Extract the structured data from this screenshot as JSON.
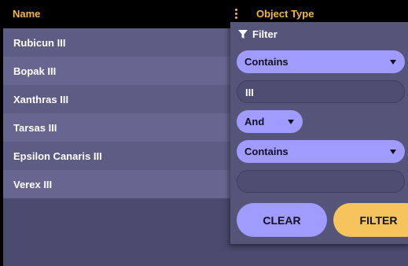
{
  "grid": {
    "columns": {
      "name": "Name",
      "object_type": "Object Type"
    },
    "rows": [
      {
        "name": "Rubicun III"
      },
      {
        "name": "Bopak III"
      },
      {
        "name": "Xanthras III"
      },
      {
        "name": "Tarsas III"
      },
      {
        "name": "Epsilon Canaris III"
      },
      {
        "name": "Verex III"
      }
    ]
  },
  "filter": {
    "title": "Filter",
    "condition1": {
      "operator": "Contains",
      "value": "III"
    },
    "join": "And",
    "condition2": {
      "operator": "Contains",
      "value": ""
    },
    "clear_label": "CLEAR",
    "apply_label": "FILTER"
  }
}
